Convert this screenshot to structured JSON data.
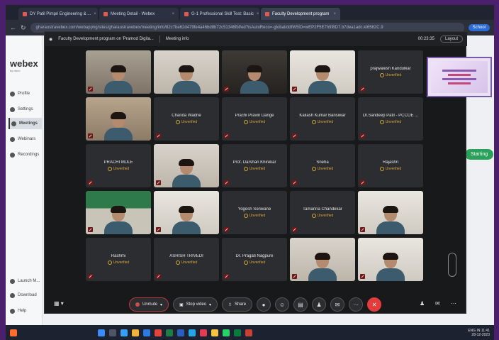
{
  "browser": {
    "tabs": [
      {
        "label": "DY Patil Pimpri Engineering & ...",
        "active": false
      },
      {
        "label": "Meeting Detail - Webex",
        "active": false
      },
      {
        "label": "G-1 Professional Skill Test: Basic",
        "active": false
      },
      {
        "label": "Faculty Development program",
        "active": true
      }
    ],
    "url": "gharaustravebex.com/webappng/sites/gharaustravebex/meeting/info/82c7be62d479fe4a46bd8b72c51346fbf/ed?isAutoReco=-global/ddIW5ID=wEP2F5E7h9f8D7.b7dea1adc.kt6582C.9",
    "school_label": "School"
  },
  "webex": {
    "brand": "webex",
    "brand_sub": "by cisco",
    "sidebar": [
      {
        "label": "Profile",
        "icon": "profile-icon"
      },
      {
        "label": "Settings",
        "icon": "gear-icon"
      },
      {
        "label": "Meetings",
        "icon": "calendar-icon",
        "active": true
      },
      {
        "label": "Webinars",
        "icon": "webinar-icon"
      },
      {
        "label": "Recordings",
        "icon": "recording-icon"
      }
    ],
    "sidebar_bottom": [
      "Launch M...",
      "Download",
      "Help"
    ],
    "green_button": "Starting"
  },
  "meeting": {
    "title": "Faculty Development program on 'Pramod Digita...",
    "info": "Meeting info",
    "time": "00:23:35",
    "layout_label": "Layout",
    "participants": [
      {
        "name": "",
        "video": true,
        "bg": "bg-office",
        "muted": true
      },
      {
        "name": "",
        "video": true,
        "bg": "bg-light",
        "muted": false
      },
      {
        "name": "",
        "video": true,
        "bg": "bg-dark",
        "muted": true
      },
      {
        "name": "",
        "video": true,
        "bg": "bg-white",
        "muted": true
      },
      {
        "name": "prajwalesh Kandulkar",
        "status": "Unverified",
        "muted": true
      },
      {
        "name": "",
        "video": true,
        "bg": "bg-room",
        "muted": true
      },
      {
        "name": "Chanda Wadne",
        "status": "Unverified",
        "muted": true
      },
      {
        "name": "Prachi Pravin Dange",
        "status": "Unverified",
        "muted": true
      },
      {
        "name": "Kailash Kumar Bansiwar",
        "status": "Unverified",
        "muted": true
      },
      {
        "name": "Dr.Sandeep Patil - PCCOE ...",
        "status": "Unverified",
        "muted": true
      },
      {
        "name": "PRACHI MULE",
        "status": "Unverified",
        "muted": true
      },
      {
        "name": "",
        "video": true,
        "bg": "bg-light",
        "muted": true
      },
      {
        "name": "Prof. Darshan Khirekar",
        "status": "Unverified",
        "muted": true
      },
      {
        "name": "Sneha",
        "status": "Unverified",
        "muted": true
      },
      {
        "name": "Rajashri",
        "status": "Unverified",
        "muted": true
      },
      {
        "name": "",
        "video": true,
        "bg": "bg-green",
        "muted": true
      },
      {
        "name": "",
        "video": true,
        "bg": "bg-white",
        "muted": true
      },
      {
        "name": "Yogesh Sonwane",
        "status": "Unverified",
        "muted": true
      },
      {
        "name": "Tamanna Chandekar",
        "status": "Unverified",
        "muted": true
      },
      {
        "name": "",
        "video": true,
        "bg": "bg-white",
        "muted": true
      },
      {
        "name": "Rashmi",
        "status": "Unverified",
        "muted": true
      },
      {
        "name": "ASHISH TRIVEDI",
        "status": "Unverified",
        "muted": true
      },
      {
        "name": "Dr. Pragati Nagpure",
        "status": "Unverified",
        "muted": true
      },
      {
        "name": "",
        "video": true,
        "bg": "bg-light",
        "muted": true
      },
      {
        "name": "",
        "video": true,
        "bg": "bg-white",
        "muted": true
      }
    ],
    "controls": {
      "unmute": "Unmute",
      "stop_video": "Stop video",
      "share": "Share"
    }
  },
  "taskbar": {
    "lang": "ENG IN",
    "time": "11:41",
    "date": "28-12-2023"
  }
}
